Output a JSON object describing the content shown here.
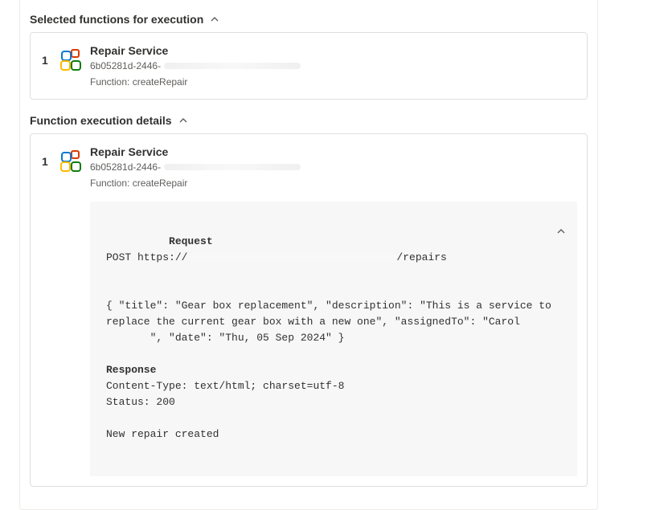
{
  "sections": {
    "selected_functions": {
      "title": "Selected functions for execution",
      "item": {
        "index": "1",
        "name": "Repair Service",
        "id_prefix": "6b05281d-2446-",
        "function_label": "Function: createRepair"
      }
    },
    "execution_details": {
      "title": "Function execution details",
      "item": {
        "index": "1",
        "name": "Repair Service",
        "id_prefix": "6b05281d-2446-",
        "function_label": "Function: createRepair"
      }
    }
  },
  "details": {
    "request_heading": "Request",
    "request_method": "POST https://",
    "request_path_suffix": "/repairs",
    "request_body": "{ \"title\": \"Gear box replacement\", \"description\": \"This is a service to replace the current gear box with a new one\", \"assignedTo\": \"Carol        \", \"date\": \"Thu, 05 Sep 2024\" }",
    "response_heading": "Response",
    "response_content_type": "Content-Type: text/html; charset=utf-8",
    "response_status": "Status: 200",
    "response_body": "New repair created"
  }
}
